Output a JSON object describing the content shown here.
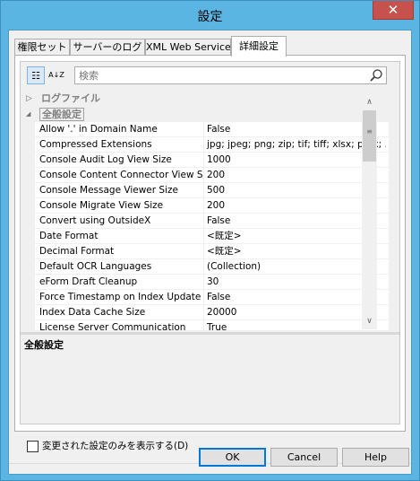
{
  "window": {
    "title": "設定",
    "close_glyph": "✕"
  },
  "tabs": [
    {
      "label": "権限セット",
      "active": false
    },
    {
      "label": "サーバーのログ",
      "active": false
    },
    {
      "label": "XML Web Service",
      "active": false
    },
    {
      "label": "詳細設定",
      "active": true
    }
  ],
  "toolbar": {
    "categorized_glyph": "☷",
    "alphabetical_glyph": "A↓Z",
    "search_placeholder": "検索"
  },
  "categories": [
    {
      "label": "ログファイル",
      "expanded": false,
      "toggle": "▷"
    },
    {
      "label": "全般設定",
      "expanded": true,
      "toggle": "◢"
    }
  ],
  "properties": [
    {
      "name": "Allow '.' in Domain Name",
      "value": "False"
    },
    {
      "name": "Compressed Extensions",
      "value": "jpg; jpeg; png; zip; tif; tiff; xlsx; pptx; ..."
    },
    {
      "name": "Console Audit Log View Size",
      "value": "1000"
    },
    {
      "name": "Console Content Connector View Size",
      "value": "200"
    },
    {
      "name": "Console Message Viewer Size",
      "value": "500"
    },
    {
      "name": "Console Migrate View Size",
      "value": "200"
    },
    {
      "name": "Convert using OutsideX",
      "value": "False"
    },
    {
      "name": "Date Format",
      "value": "<既定>"
    },
    {
      "name": "Decimal Format",
      "value": "<既定>"
    },
    {
      "name": "Default OCR Languages",
      "value": "(Collection)"
    },
    {
      "name": "eForm Draft Cleanup",
      "value": "30"
    },
    {
      "name": "Force Timestamp on Index Update",
      "value": "False"
    },
    {
      "name": "Index Data Cache Size",
      "value": "20000"
    },
    {
      "name": "License Server Communication",
      "value": "True"
    }
  ],
  "scrollbar": {
    "up_glyph": "∧",
    "down_glyph": "∨",
    "grip_glyph": "≡"
  },
  "description": {
    "title": "全般設定"
  },
  "checkbox": {
    "label": "変更された設定のみを表示する(D)",
    "checked": false
  },
  "buttons": {
    "ok": "OK",
    "cancel": "Cancel",
    "help": "Help"
  },
  "colors": {
    "title_bar": "#5bb5e3",
    "close_button": "#c7514c",
    "default_button_border": "#0078d7"
  }
}
